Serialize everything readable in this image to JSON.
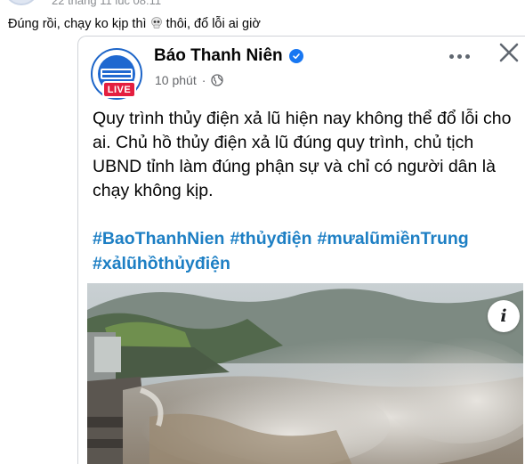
{
  "outer_post": {
    "timestamp": "22 tháng 11 lúc 08:11",
    "caption_before": "Đúng rồi, chạy ko kịp thì ",
    "caption_emoji": "skull-emoji",
    "caption_after": " thôi, đổ lỗi ai giờ"
  },
  "shared_post": {
    "page_name": "Báo Thanh Niên",
    "verified": true,
    "live_label": "LIVE",
    "time_ago": "10 phút",
    "separator": "·",
    "privacy_icon": "globe-icon",
    "body_text": "Quy trình thủy điện xả lũ hiện nay không thể đổ lỗi cho ai. Chủ hồ thủy điện xả lũ đúng quy trình, chủ tịch UBND tỉnh làm đúng phận sự và chỉ có người dân là chạy không kịp.",
    "hashtags": [
      "#BaoThanhNien",
      "#thủyđiện",
      "#mưalũmiềnTrung",
      "#xảlũhồthủyđiện"
    ],
    "info_glyph": "i",
    "image_subject": "hydropower dam releasing flood water"
  },
  "colors": {
    "hashtag": "#1d7fc4",
    "live_badge": "#e41e3f",
    "verified": "#1877f2",
    "meta": "#65676b"
  }
}
